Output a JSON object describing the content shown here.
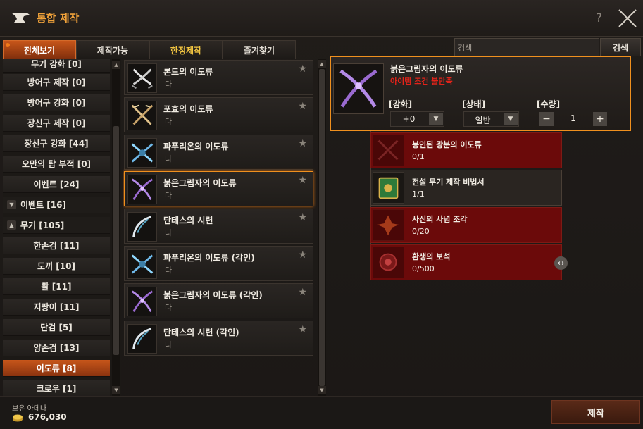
{
  "window": {
    "title": "통합 제작"
  },
  "tabs": [
    {
      "label": "전체보기"
    },
    {
      "label": "제작가능"
    },
    {
      "label": "한정제작"
    },
    {
      "label": "즐겨찾기"
    }
  ],
  "search": {
    "placeholder": "검색",
    "button": "검색"
  },
  "categories": [
    {
      "label": "무기 강화 [0]"
    },
    {
      "label": "방어구 제작 [0]"
    },
    {
      "label": "방어구 강화 [0]"
    },
    {
      "label": "장신구 제작 [0]"
    },
    {
      "label": "장신구 강화 [44]"
    },
    {
      "label": "오만의 탑 부적 [0]"
    },
    {
      "label": "이벤트 [24]"
    },
    {
      "label": "이벤트 [16]"
    },
    {
      "label": "무기 [105]"
    },
    {
      "label": "한손검 [11]"
    },
    {
      "label": "도끼 [10]"
    },
    {
      "label": "활 [11]"
    },
    {
      "label": "지팡이 [11]"
    },
    {
      "label": "단검 [5]"
    },
    {
      "label": "양손검 [13]"
    },
    {
      "label": "이도류 [8]"
    },
    {
      "label": "크로우 [1]"
    }
  ],
  "items": [
    {
      "name": "론드의 이도류",
      "grade": "다"
    },
    {
      "name": "포효의 이도류",
      "grade": "다"
    },
    {
      "name": "파푸리온의 이도류",
      "grade": "다"
    },
    {
      "name": "붉은그림자의 이도류",
      "grade": "다"
    },
    {
      "name": "단테스의 시련",
      "grade": "다"
    },
    {
      "name": "파푸리온의 이도류 (각인)",
      "grade": "다"
    },
    {
      "name": "붉은그림자의 이도류 (각인)",
      "grade": "다"
    },
    {
      "name": "단테스의 시련 (각인)",
      "grade": "다"
    }
  ],
  "detail": {
    "name": "붉은그림자의 이도류",
    "warning": "아이템 조건 불만족",
    "enchant_label": "[강화]",
    "enchant_value": "+0",
    "state_label": "[상태]",
    "state_value": "일반",
    "qty_label": "[수량]",
    "qty_value": "1",
    "minus": "−",
    "plus": "+"
  },
  "materials": [
    {
      "name": "봉인된 광분의 이도류",
      "count": "0/1"
    },
    {
      "name": "전설 무기 제작 비법서",
      "count": "1/1"
    },
    {
      "name": "사신의 사념 조각",
      "count": "0/20"
    },
    {
      "name": "환생의 보석",
      "count": "0/500"
    }
  ],
  "bottom": {
    "money_label": "보유 아데나",
    "money_value": "676,030",
    "craft_button": "제작"
  }
}
